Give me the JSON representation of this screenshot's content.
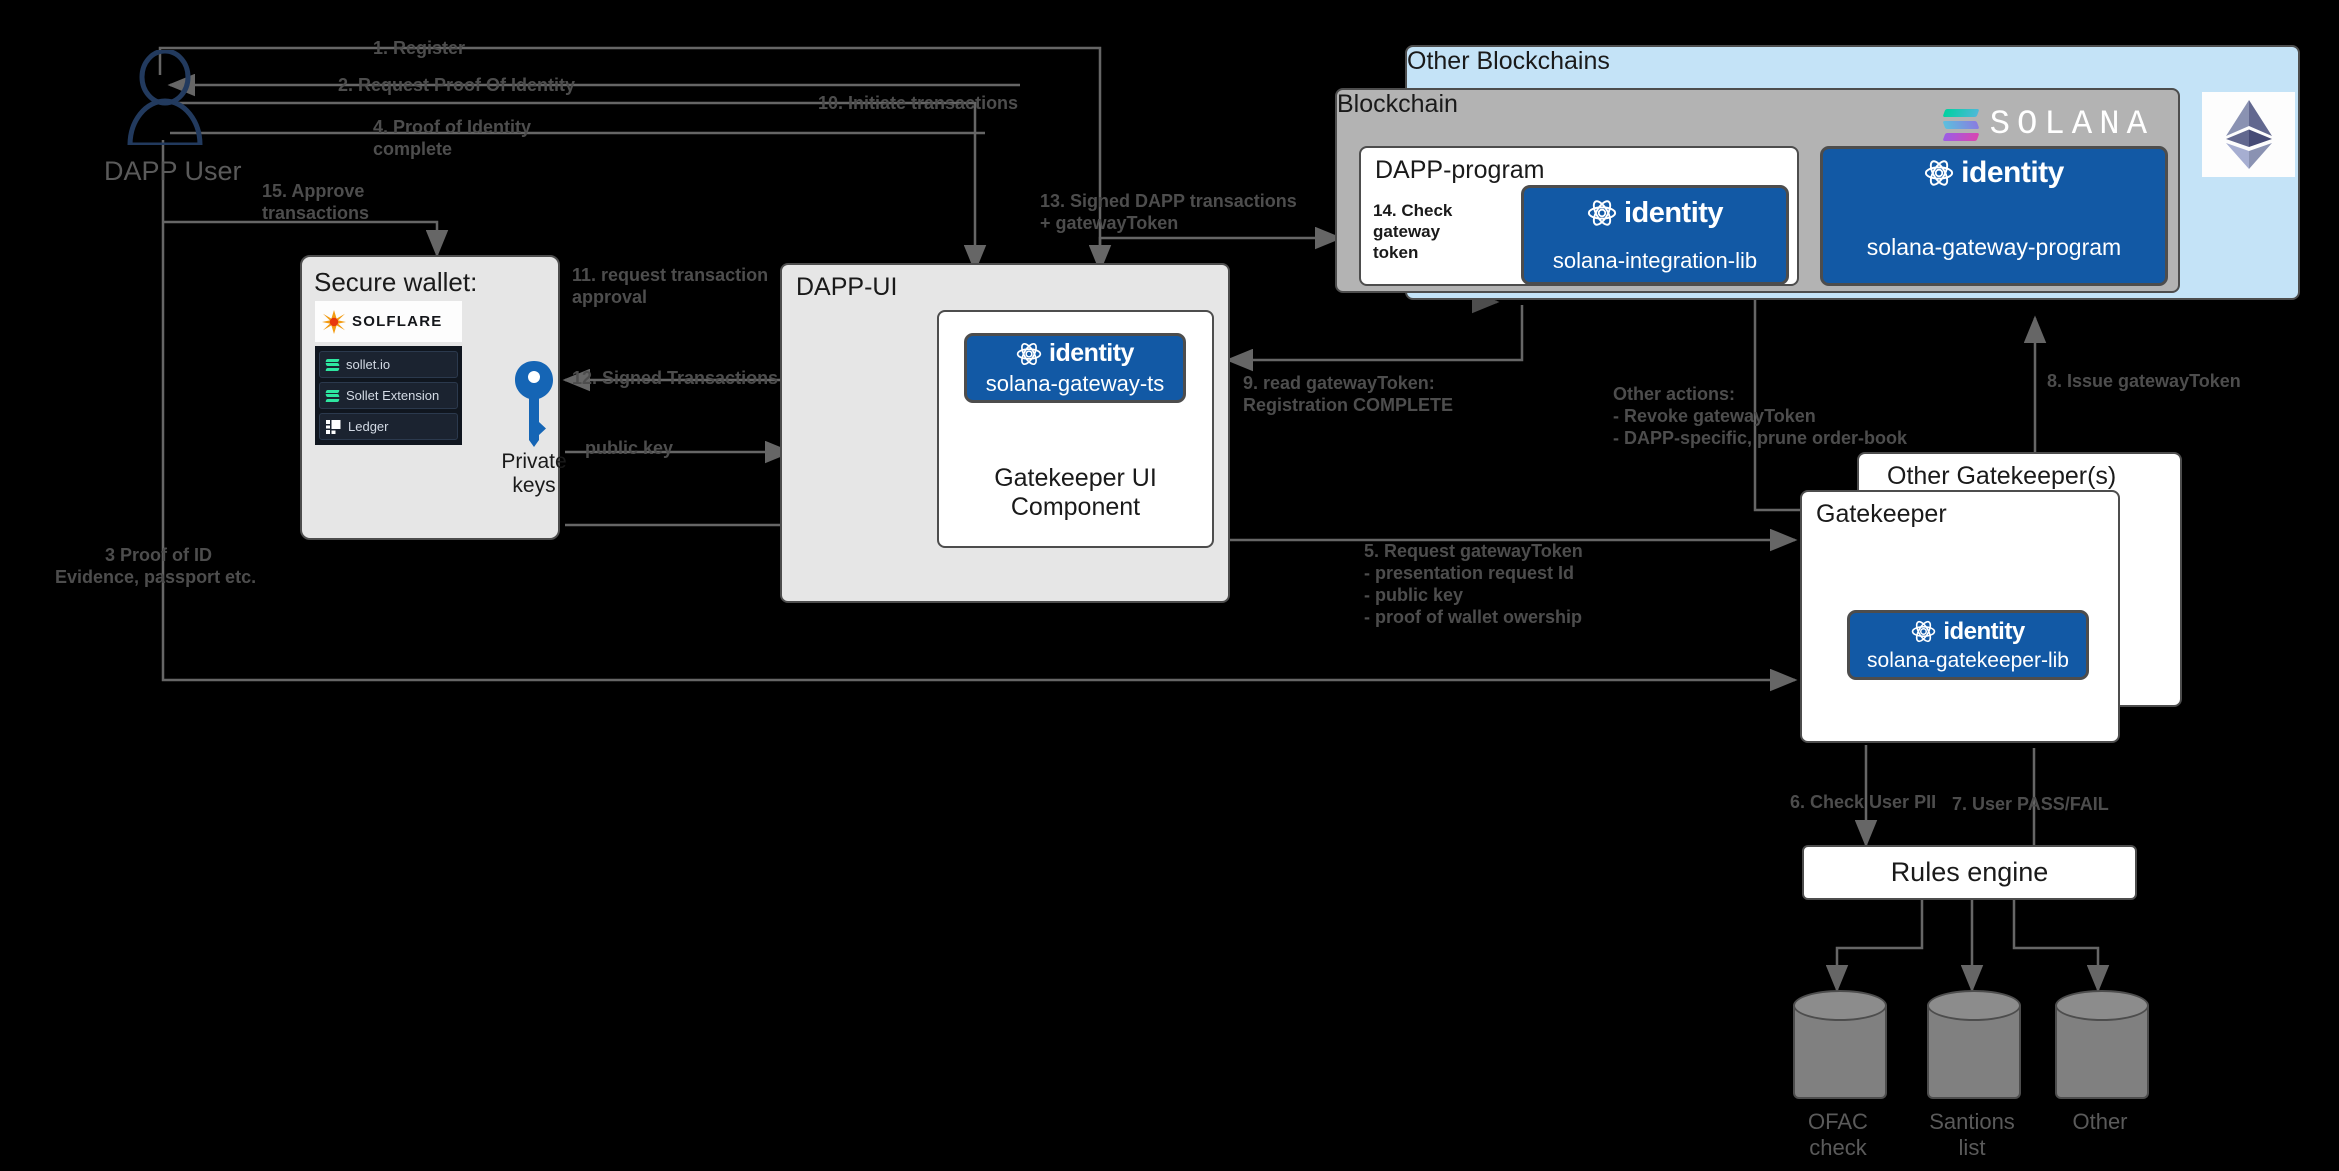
{
  "actors": {
    "user_label": "DAPP User"
  },
  "wallet": {
    "title": "Secure wallet:",
    "brand": "SOLFLARE",
    "providers": [
      {
        "name": "sollet.io",
        "icon": "solana-mark-icon"
      },
      {
        "name": "Sollet Extension",
        "icon": "solana-mark-icon"
      },
      {
        "name": "Ledger",
        "icon": "ledger-mark-icon"
      }
    ],
    "keys_label_line1": "Private",
    "keys_label_line2": "keys",
    "keys_icon": "key-icon"
  },
  "dapp_ui": {
    "title": "DAPP-UI",
    "gatekeeper_component": {
      "line1": "Gatekeeper UI",
      "line2": "Component"
    },
    "chip": {
      "brand": "identity",
      "sub": "solana-gateway-ts",
      "icon": "atom-identity-icon"
    }
  },
  "other_blockchains": {
    "title": "Other Blockchains",
    "logo": "ethereum-icon"
  },
  "blockchain": {
    "title": "Blockchain",
    "logo_word": "SOLANA",
    "logo_icon": "solana-logo-icon",
    "dapp_program": {
      "title": "DAPP-program",
      "step14": "14. Check\ngateway\ntoken",
      "chip": {
        "brand": "identity",
        "sub": "solana-integration-lib",
        "icon": "atom-identity-icon"
      }
    },
    "gateway_program_chip": {
      "brand": "identity",
      "sub": "solana-gateway-program",
      "icon": "atom-identity-icon"
    }
  },
  "gatekeepers": {
    "other_title": "Other Gatekeeper(s)",
    "title": "Gatekeeper",
    "chip": {
      "brand": "identity",
      "sub": "solana-gatekeeper-lib",
      "icon": "atom-identity-icon"
    }
  },
  "rules_engine": {
    "title": "Rules engine"
  },
  "datastores": [
    {
      "line1": "OFAC",
      "line2": "check"
    },
    {
      "line1": "Santions",
      "line2": "list"
    },
    {
      "line1": "Other",
      "line2": ""
    }
  ],
  "flows": [
    {
      "id": "f1",
      "text": "1. Register"
    },
    {
      "id": "f2",
      "text": "2. Request Proof Of Identity"
    },
    {
      "id": "f3a",
      "text": "3 Proof of ID"
    },
    {
      "id": "f3b",
      "text": "Evidence, passport etc."
    },
    {
      "id": "f4a",
      "text": "4. Proof of Identity"
    },
    {
      "id": "f4b",
      "text": "complete"
    },
    {
      "id": "f5a",
      "text": "5. Request gatewayToken"
    },
    {
      "id": "f5b",
      "text": "- presentation request Id"
    },
    {
      "id": "f5c",
      "text": "- public key"
    },
    {
      "id": "f5d",
      "text": "- proof of wallet owership"
    },
    {
      "id": "f6",
      "text": "6. Check User PII"
    },
    {
      "id": "f7",
      "text": "7. User PASS/FAIL"
    },
    {
      "id": "f8",
      "text": "8. Issue gatewayToken"
    },
    {
      "id": "f9a",
      "text": "9. read gatewayToken:"
    },
    {
      "id": "f9b",
      "text": "Registration COMPLETE"
    },
    {
      "id": "f10",
      "text": "10. Initiate transactions"
    },
    {
      "id": "f11a",
      "text": "11. request transaction"
    },
    {
      "id": "f11b",
      "text": "approval"
    },
    {
      "id": "f12",
      "text": "12. Signed Transactions"
    },
    {
      "id": "f13a",
      "text": "13. Signed DAPP transactions"
    },
    {
      "id": "f13b",
      "text": "+ gatewayToken"
    },
    {
      "id": "f15a",
      "text": "15. Approve"
    },
    {
      "id": "f15b",
      "text": "transactions"
    },
    {
      "id": "fpk",
      "text": "public key"
    },
    {
      "id": "foa",
      "text": "Other actions:"
    },
    {
      "id": "fob",
      "text": "- Revoke gatewayToken"
    },
    {
      "id": "foc",
      "text": "- DAPP-specific, prune order-book"
    }
  ],
  "colors": {
    "identity_blue": "#1259a5",
    "blockchain_gray": "#b3b3b3",
    "other_chain_blue": "#c4e3f7",
    "wire": "#666666",
    "panel_border": "#4d4d4d"
  }
}
